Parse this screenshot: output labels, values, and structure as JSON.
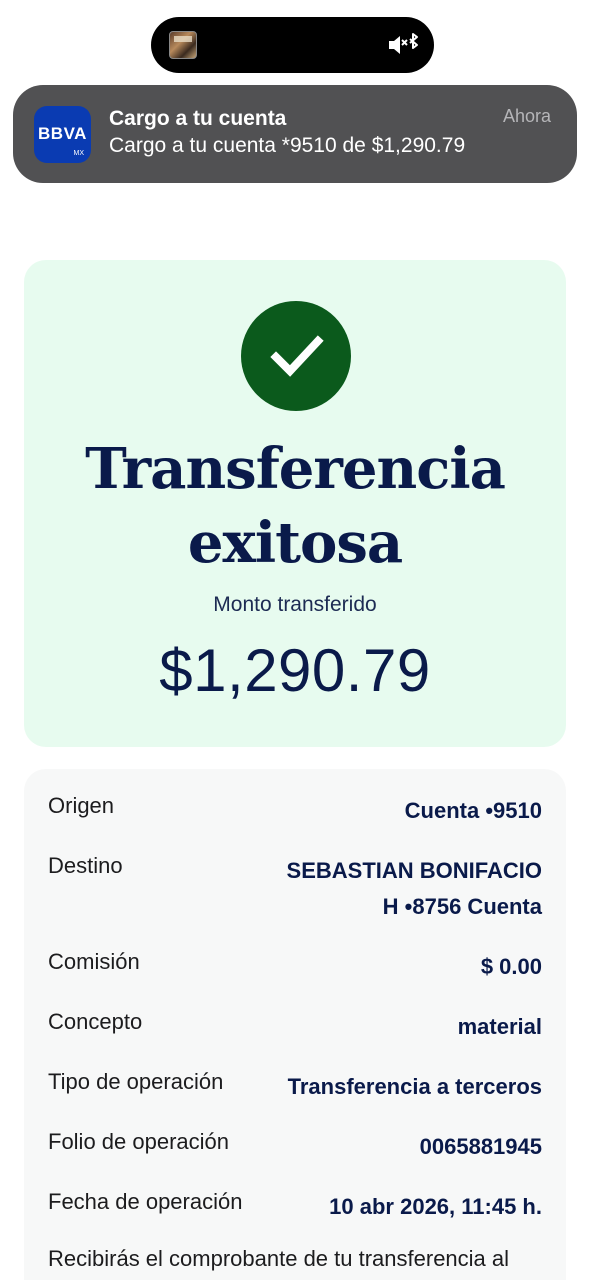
{
  "notification": {
    "app_icon_text": "BBVA",
    "app_icon_sub": "MX",
    "title": "Cargo a tu cuenta",
    "body": "Cargo a tu cuenta *9510 de $1,290.79",
    "time": "Ahora"
  },
  "success": {
    "icon": "check-icon",
    "title_line1": "Transferencia",
    "title_line2": "exitosa",
    "amount_label": "Monto transferido",
    "amount": "$1,290.79"
  },
  "details": {
    "origen_label": "Origen",
    "origen_value": "Cuenta •9510",
    "destino_label": "Destino",
    "destino_value_line1": "SEBASTIAN BONIFACIO",
    "destino_value_line2": "H •8756 Cuenta",
    "comision_label": "Comisión",
    "comision_value": "$ 0.00",
    "concepto_label": "Concepto",
    "concepto_value": "material",
    "tipo_label": "Tipo de operación",
    "tipo_value": "Transferencia a terceros",
    "folio_label": "Folio de operación",
    "folio_value": "0065881945",
    "fecha_label": "Fecha de operación",
    "fecha_value": "10 abr 2026, 11:45 h.",
    "footer": "Recibirás el comprobante de tu transferencia al"
  },
  "colors": {
    "success_bg": "#e7fbef",
    "check_green": "#0b5a1c",
    "navy": "#0a1a4a",
    "bbva_blue": "#0a3bb2"
  }
}
